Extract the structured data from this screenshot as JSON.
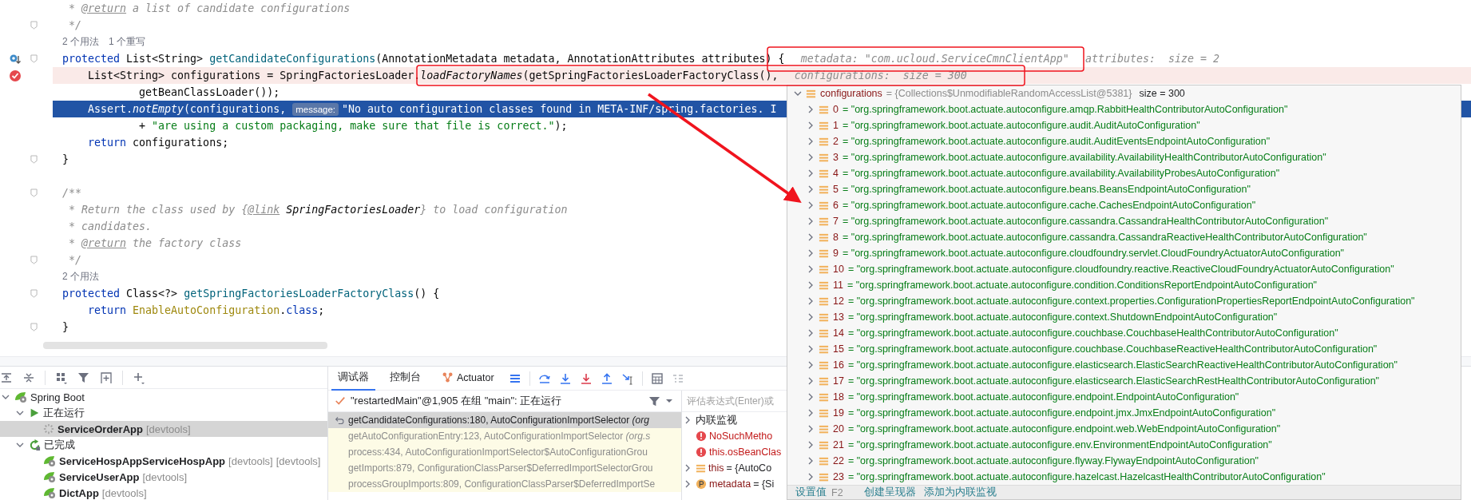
{
  "editor": {
    "lines": [
      {
        "kind": "code",
        "fold": false,
        "segments": [
          {
            "text": " * ",
            "kind": "comment"
          },
          {
            "text": "@return",
            "kind": "doctag"
          },
          {
            "text": " a list of candidate configurations",
            "kind": "comment"
          }
        ]
      },
      {
        "kind": "code",
        "fold": true,
        "segments": [
          {
            "text": " */",
            "kind": "comment"
          }
        ]
      },
      {
        "kind": "usage",
        "fold": false,
        "items": [
          "2 个用法",
          "1 个重写"
        ]
      },
      {
        "kind": "code",
        "fold": true,
        "override_marker": true,
        "segments": [
          {
            "text": "protected ",
            "kind": "kw"
          },
          {
            "text": "List<String> ",
            "kind": "plain"
          },
          {
            "text": "getCandidateConfigurations",
            "kind": "method"
          },
          {
            "text": "(AnnotationMetadata metadata, AnnotationAttributes attributes) {",
            "kind": "plain"
          }
        ],
        "hints": [
          "metadata: \"com.ucloud.ServiceCmnClientApp\"",
          "attributes:  size = 2"
        ]
      },
      {
        "kind": "code",
        "fold": false,
        "breakpoint": true,
        "segments": [
          {
            "text": "    List<String> configurations = SpringFactoriesLoader.",
            "kind": "plain"
          },
          {
            "text": "loadFactoryNames",
            "kind": "italic"
          },
          {
            "text": "(getSpringFactoriesLoaderFactoryClass(),",
            "kind": "plain"
          }
        ],
        "hints": [
          "configurations:  size = 300"
        ]
      },
      {
        "kind": "code",
        "fold": false,
        "segments": [
          {
            "text": "            getBeanClassLoader());",
            "kind": "plain"
          }
        ]
      },
      {
        "kind": "code",
        "fold": false,
        "current": true,
        "segments": [
          {
            "text": "    Assert.",
            "kind": "plain"
          },
          {
            "text": "notEmpty",
            "kind": "italic"
          },
          {
            "text": "(configurations, ",
            "kind": "plain"
          },
          {
            "text": "message:",
            "kind": "param"
          },
          {
            "text": "\"No auto configuration classes found in META-INF/spring.factories. I",
            "kind": "string"
          }
        ]
      },
      {
        "kind": "code",
        "fold": false,
        "segments": [
          {
            "text": "            + ",
            "kind": "plain"
          },
          {
            "text": "\"are using a custom packaging, make sure that file is correct.\"",
            "kind": "string"
          },
          {
            "text": ");",
            "kind": "plain"
          }
        ]
      },
      {
        "kind": "code",
        "fold": false,
        "segments": [
          {
            "text": "    return ",
            "kind": "kw"
          },
          {
            "text": "configurations;",
            "kind": "plain"
          }
        ]
      },
      {
        "kind": "code",
        "fold": true,
        "segments": [
          {
            "text": "}",
            "kind": "plain"
          }
        ]
      },
      {
        "kind": "code",
        "fold": false
      },
      {
        "kind": "code",
        "fold": true,
        "segments": [
          {
            "text": "/**",
            "kind": "comment"
          }
        ]
      },
      {
        "kind": "code",
        "fold": false,
        "segments": [
          {
            "text": " * Return the class used by {",
            "kind": "comment"
          },
          {
            "text": "@link",
            "kind": "doctag"
          },
          {
            "text": " SpringFactoriesLoader",
            "kind": "doclink"
          },
          {
            "text": "} to load configuration",
            "kind": "comment"
          }
        ]
      },
      {
        "kind": "code",
        "fold": false,
        "segments": [
          {
            "text": " * candidates.",
            "kind": "comment"
          }
        ]
      },
      {
        "kind": "code",
        "fold": false,
        "segments": [
          {
            "text": " * ",
            "kind": "comment"
          },
          {
            "text": "@return",
            "kind": "doctag"
          },
          {
            "text": " the factory class",
            "kind": "comment"
          }
        ]
      },
      {
        "kind": "code",
        "fold": true,
        "segments": [
          {
            "text": " */",
            "kind": "comment"
          }
        ]
      },
      {
        "kind": "usage",
        "fold": false,
        "items": [
          "2 个用法"
        ]
      },
      {
        "kind": "code",
        "fold": true,
        "segments": [
          {
            "text": "protected ",
            "kind": "kw"
          },
          {
            "text": "Class<?> ",
            "kind": "plain"
          },
          {
            "text": "getSpringFactoriesLoaderFactoryClass",
            "kind": "method"
          },
          {
            "text": "() {",
            "kind": "plain"
          }
        ]
      },
      {
        "kind": "code",
        "fold": false,
        "segments": [
          {
            "text": "    return ",
            "kind": "kw"
          },
          {
            "text": "EnableAutoConfiguration",
            "kind": "type"
          },
          {
            "text": ".",
            "kind": "plain"
          },
          {
            "text": "class",
            "kind": "kw"
          },
          {
            "text": ";",
            "kind": "plain"
          }
        ]
      },
      {
        "kind": "code",
        "fold": true,
        "segments": [
          {
            "text": "}",
            "kind": "plain"
          }
        ]
      }
    ]
  },
  "services": {
    "tree": [
      {
        "label": "Spring Boot",
        "kind": "spring",
        "bold": false,
        "selected": false,
        "expanded": true,
        "children": [
          {
            "label": "正在运行",
            "kind": "run",
            "bold": false,
            "selected": false,
            "expanded": true,
            "children": [
              {
                "label": "ServiceOrderApp",
                "kind": "loading",
                "bold": true,
                "selected": true,
                "tags": [
                  "[devtools]"
                ]
              }
            ]
          },
          {
            "label": "已完成",
            "kind": "rerun",
            "bold": false,
            "selected": false,
            "expanded": true,
            "children": [
              {
                "label": "ServiceHospAppServiceHospApp",
                "kind": "spring",
                "bold": true,
                "selected": false,
                "tags": [
                  "[devtools]",
                  "[devtools]"
                ]
              },
              {
                "label": "ServiceUserApp",
                "kind": "spring",
                "bold": true,
                "selected": false,
                "tags": [
                  "[devtools]"
                ]
              },
              {
                "label": "DictApp",
                "kind": "spring",
                "bold": true,
                "selected": false,
                "tags": [
                  "[devtools]"
                ]
              }
            ]
          }
        ]
      }
    ]
  },
  "debugger": {
    "tabs": [
      {
        "label": "调试器",
        "selected": true,
        "kind": "text"
      },
      {
        "label": "控制台",
        "selected": false,
        "kind": "text"
      },
      {
        "label": "Actuator",
        "selected": false,
        "kind": "actuator"
      }
    ],
    "thread": "\"restartedMain\"@1,905 在组 \"main\": 正在运行",
    "frames": [
      {
        "text": "getCandidateConfigurations:180, AutoConfigurationImportSelector *(org*",
        "selected": true
      },
      {
        "text": "getAutoConfigurationEntry:123, AutoConfigurationImportSelector *(org.s*",
        "selected": false
      },
      {
        "text": "process:434, AutoConfigurationImportSelector$AutoConfigurationGrou",
        "selected": false
      },
      {
        "text": "getImports:879, ConfigurationClassParser$DeferredImportSelectorGrou",
        "selected": false
      },
      {
        "text": "processGroupImports:809, ConfigurationClassParser$DeferredImportSe",
        "selected": false
      }
    ],
    "variables": {
      "placeholder": "评估表达式(Enter)或",
      "items": [
        {
          "kind": "watch",
          "name": "内联监视",
          "expanded": false
        },
        {
          "kind": "error",
          "name": "NoSuchMetho"
        },
        {
          "kind": "error",
          "name": "this.osBeanClas"
        },
        {
          "kind": "object",
          "name": "this",
          "value": "= {AutoCo",
          "expanded": false
        },
        {
          "kind": "param",
          "name": "metadata",
          "value": "= {Si",
          "expanded": false
        }
      ]
    }
  },
  "popup": {
    "root": {
      "name": "configurations",
      "value": "= {Collections$UnmodifiableRandomAccessList@5381}",
      "size": "size = 300",
      "expanded": true
    },
    "items": [
      {
        "name": "0",
        "value": "= \"org.springframework.boot.actuate.autoconfigure.amqp.RabbitHealthContributorAutoConfiguration\"",
        "expanded": false
      },
      {
        "name": "1",
        "value": "= \"org.springframework.boot.actuate.autoconfigure.audit.AuditAutoConfiguration\"",
        "expanded": false
      },
      {
        "name": "2",
        "value": "= \"org.springframework.boot.actuate.autoconfigure.audit.AuditEventsEndpointAutoConfiguration\"",
        "expanded": false
      },
      {
        "name": "3",
        "value": "= \"org.springframework.boot.actuate.autoconfigure.availability.AvailabilityHealthContributorAutoConfiguration\"",
        "expanded": false
      },
      {
        "name": "4",
        "value": "= \"org.springframework.boot.actuate.autoconfigure.availability.AvailabilityProbesAutoConfiguration\"",
        "expanded": false
      },
      {
        "name": "5",
        "value": "= \"org.springframework.boot.actuate.autoconfigure.beans.BeansEndpointAutoConfiguration\"",
        "expanded": false
      },
      {
        "name": "6",
        "value": "= \"org.springframework.boot.actuate.autoconfigure.cache.CachesEndpointAutoConfiguration\"",
        "expanded": false
      },
      {
        "name": "7",
        "value": "= \"org.springframework.boot.actuate.autoconfigure.cassandra.CassandraHealthContributorAutoConfiguration\"",
        "expanded": false
      },
      {
        "name": "8",
        "value": "= \"org.springframework.boot.actuate.autoconfigure.cassandra.CassandraReactiveHealthContributorAutoConfiguration\"",
        "expanded": false
      },
      {
        "name": "9",
        "value": "= \"org.springframework.boot.actuate.autoconfigure.cloudfoundry.servlet.CloudFoundryActuatorAutoConfiguration\"",
        "expanded": false
      },
      {
        "name": "10",
        "value": "= \"org.springframework.boot.actuate.autoconfigure.cloudfoundry.reactive.ReactiveCloudFoundryActuatorAutoConfiguration\"",
        "expanded": false
      },
      {
        "name": "11",
        "value": "= \"org.springframework.boot.actuate.autoconfigure.condition.ConditionsReportEndpointAutoConfiguration\"",
        "expanded": false
      },
      {
        "name": "12",
        "value": "= \"org.springframework.boot.actuate.autoconfigure.context.properties.ConfigurationPropertiesReportEndpointAutoConfiguration\"",
        "expanded": false
      },
      {
        "name": "13",
        "value": "= \"org.springframework.boot.actuate.autoconfigure.context.ShutdownEndpointAutoConfiguration\"",
        "expanded": false
      },
      {
        "name": "14",
        "value": "= \"org.springframework.boot.actuate.autoconfigure.couchbase.CouchbaseHealthContributorAutoConfiguration\"",
        "expanded": false
      },
      {
        "name": "15",
        "value": "= \"org.springframework.boot.actuate.autoconfigure.couchbase.CouchbaseReactiveHealthContributorAutoConfiguration\"",
        "expanded": false
      },
      {
        "name": "16",
        "value": "= \"org.springframework.boot.actuate.autoconfigure.elasticsearch.ElasticSearchReactiveHealthContributorAutoConfiguration\"",
        "expanded": false
      },
      {
        "name": "17",
        "value": "= \"org.springframework.boot.actuate.autoconfigure.elasticsearch.ElasticSearchRestHealthContributorAutoConfiguration\"",
        "expanded": false
      },
      {
        "name": "18",
        "value": "= \"org.springframework.boot.actuate.autoconfigure.endpoint.EndpointAutoConfiguration\"",
        "expanded": false
      },
      {
        "name": "19",
        "value": "= \"org.springframework.boot.actuate.autoconfigure.endpoint.jmx.JmxEndpointAutoConfiguration\"",
        "expanded": false
      },
      {
        "name": "20",
        "value": "= \"org.springframework.boot.actuate.autoconfigure.endpoint.web.WebEndpointAutoConfiguration\"",
        "expanded": false
      },
      {
        "name": "21",
        "value": "= \"org.springframework.boot.actuate.autoconfigure.env.EnvironmentEndpointAutoConfiguration\"",
        "expanded": false
      },
      {
        "name": "22",
        "value": "= \"org.springframework.boot.actuate.autoconfigure.flyway.FlywayEndpointAutoConfiguration\"",
        "expanded": false
      },
      {
        "name": "23",
        "value": "= \"org.springframework.boot.actuate.autoconfigure.hazelcast.HazelcastHealthContributorAutoConfiguration\"",
        "expanded": false
      }
    ],
    "actions": [
      {
        "label": "设置值",
        "shortcut": "F2"
      },
      {
        "label": "创建呈现器"
      },
      {
        "label": "添加为内联监视"
      }
    ]
  }
}
